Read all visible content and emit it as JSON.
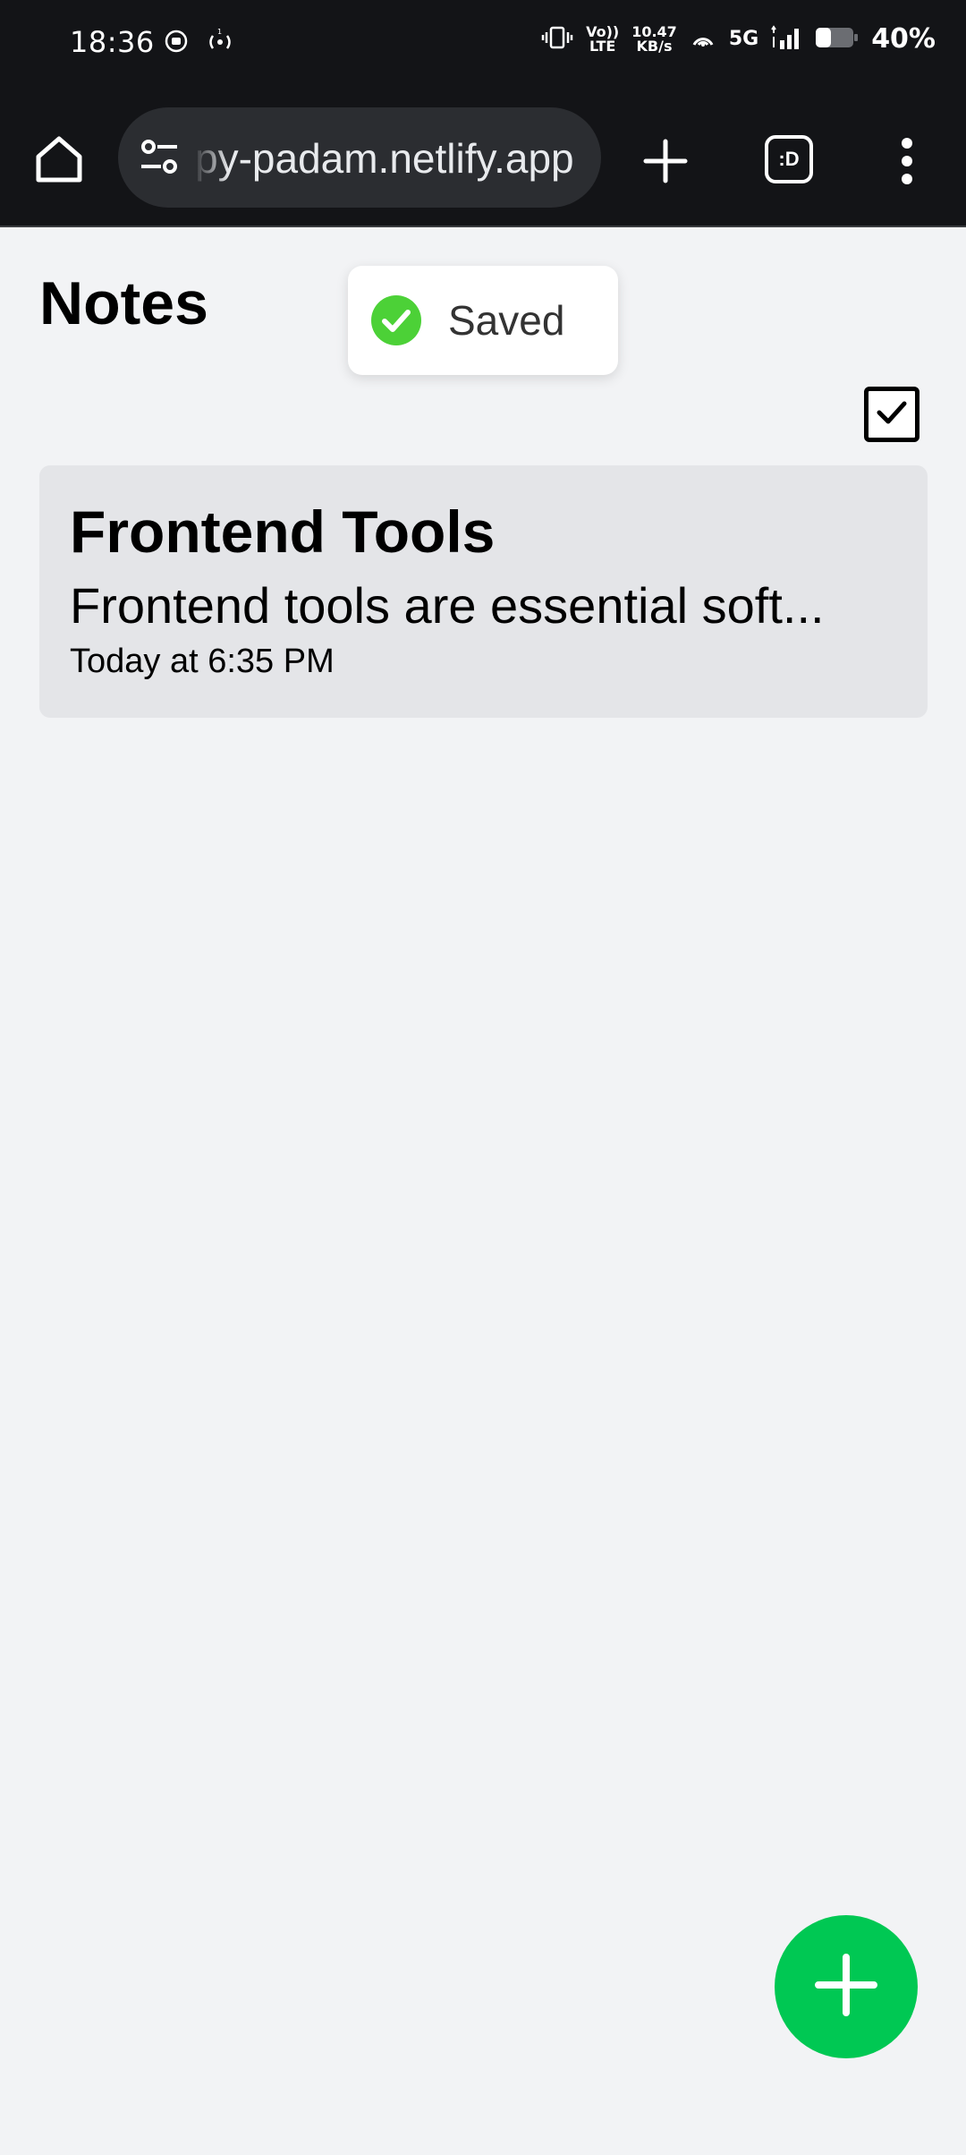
{
  "status_bar": {
    "time": "18:36",
    "network_speed_value": "10.47",
    "network_speed_unit": "KB/s",
    "volte_top": "Vo))",
    "volte_bottom": "LTE",
    "network_type": "5G",
    "battery_percent": "40%",
    "battery_level": 0.4
  },
  "browser": {
    "url": "py-padam.netlify.app",
    "tab_count_label": ":D"
  },
  "app": {
    "title": "Notes",
    "toast": {
      "text": "Saved",
      "color": "#4cd137"
    },
    "notes": [
      {
        "title": "Frontend Tools",
        "preview": "Frontend tools are essential soft...",
        "date": "Today at 6:35 PM"
      }
    ],
    "fab_color": "#00c853"
  },
  "icons": {
    "home": "home-icon",
    "site_settings": "site-settings-icon",
    "new_tab": "plus-icon",
    "tabs": "tab-switcher-icon",
    "menu": "more-vert-icon",
    "select": "checkbox-icon",
    "add_note": "plus-icon",
    "toast": "check-circle-icon"
  }
}
